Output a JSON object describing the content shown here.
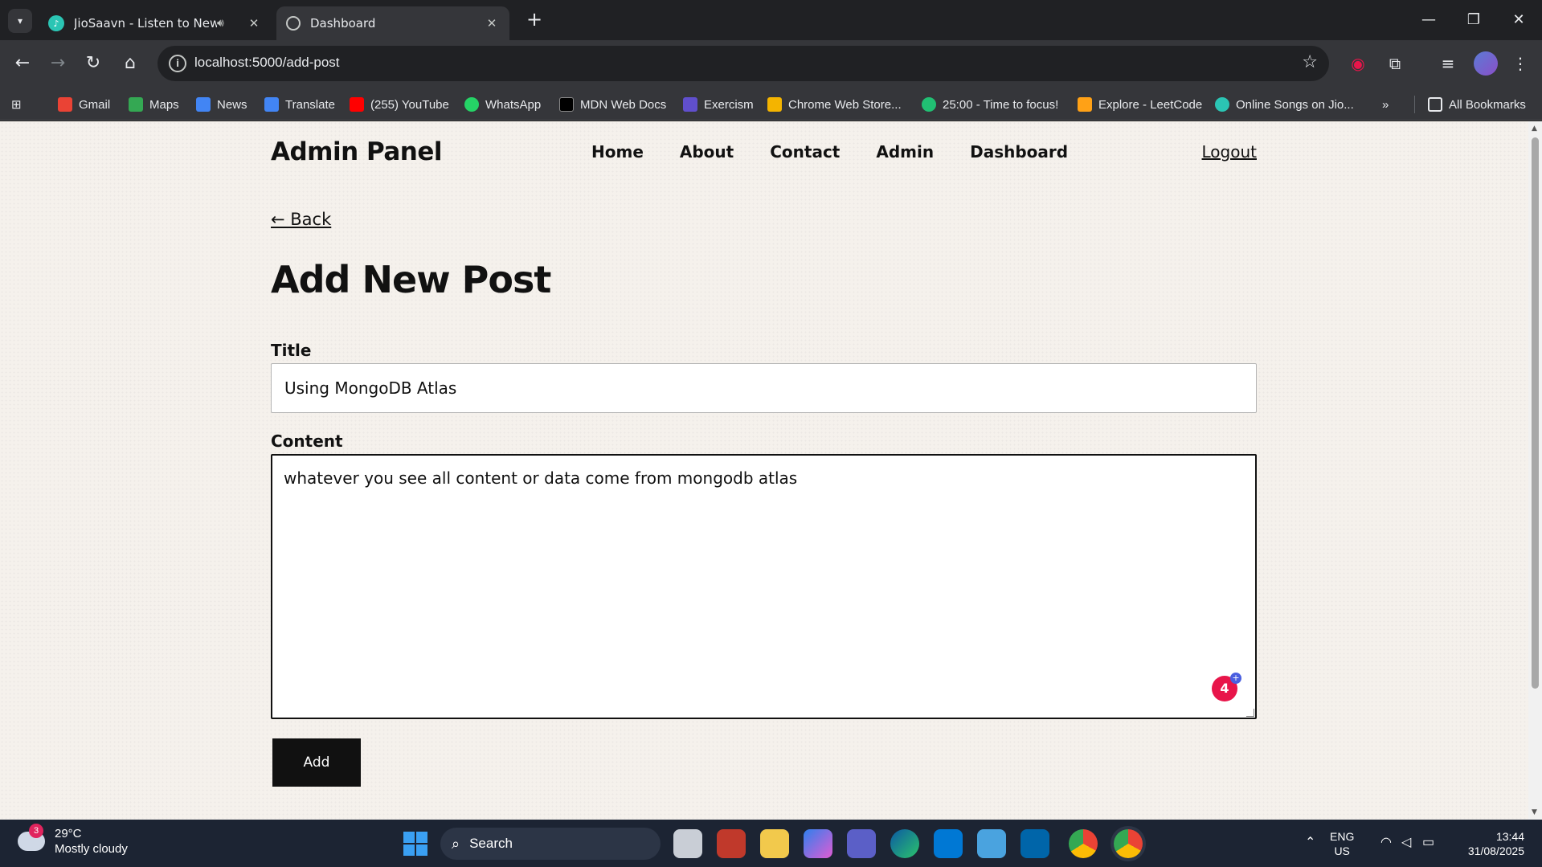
{
  "browser": {
    "tabs": [
      {
        "title": "JioSaavn - Listen to New &",
        "favicon": "jiosaavn-icon",
        "audio": true
      },
      {
        "title": "Dashboard",
        "favicon": "globe-icon",
        "active": true
      }
    ],
    "url": "localhost:5000/add-post",
    "bookmarks": [
      {
        "label": "Gmail",
        "color": "#ea4335"
      },
      {
        "label": "Maps",
        "color": "#34a853"
      },
      {
        "label": "News",
        "color": "#4285f4"
      },
      {
        "label": "Translate",
        "color": "#4285f4"
      },
      {
        "label": "(255) YouTube",
        "color": "#ff0000"
      },
      {
        "label": "WhatsApp",
        "color": "#25d366"
      },
      {
        "label": "MDN Web Docs",
        "color": "#000000"
      },
      {
        "label": "Exercism",
        "color": "#604fcd"
      },
      {
        "label": "Chrome Web Store...",
        "color": "#f4b400"
      },
      {
        "label": "25:00 - Time to focus!",
        "color": "#21bf73"
      },
      {
        "label": "Explore - LeetCode",
        "color": "#ffa116"
      },
      {
        "label": "Online Songs on Jio...",
        "color": "#2bc5b4"
      }
    ],
    "all_bookmarks": "All Bookmarks"
  },
  "site": {
    "logo": "Admin Panel",
    "nav": [
      "Home",
      "About",
      "Contact",
      "Admin",
      "Dashboard"
    ],
    "logout": "Logout"
  },
  "page": {
    "back_link": "← Back",
    "title": "Add New Post",
    "title_label": "Title",
    "title_value": "Using MongoDB Atlas",
    "content_label": "Content",
    "content_value": "whatever you see all content or data come from mongodb atlas",
    "grammar_count": "4",
    "submit_label": "Add"
  },
  "taskbar": {
    "weather_temp": "29°C",
    "weather_desc": "Mostly cloudy",
    "weather_badge": "3",
    "search_label": "Search",
    "lang_line1": "ENG",
    "lang_line2": "US",
    "time": "13:44",
    "date": "31/08/2025"
  }
}
